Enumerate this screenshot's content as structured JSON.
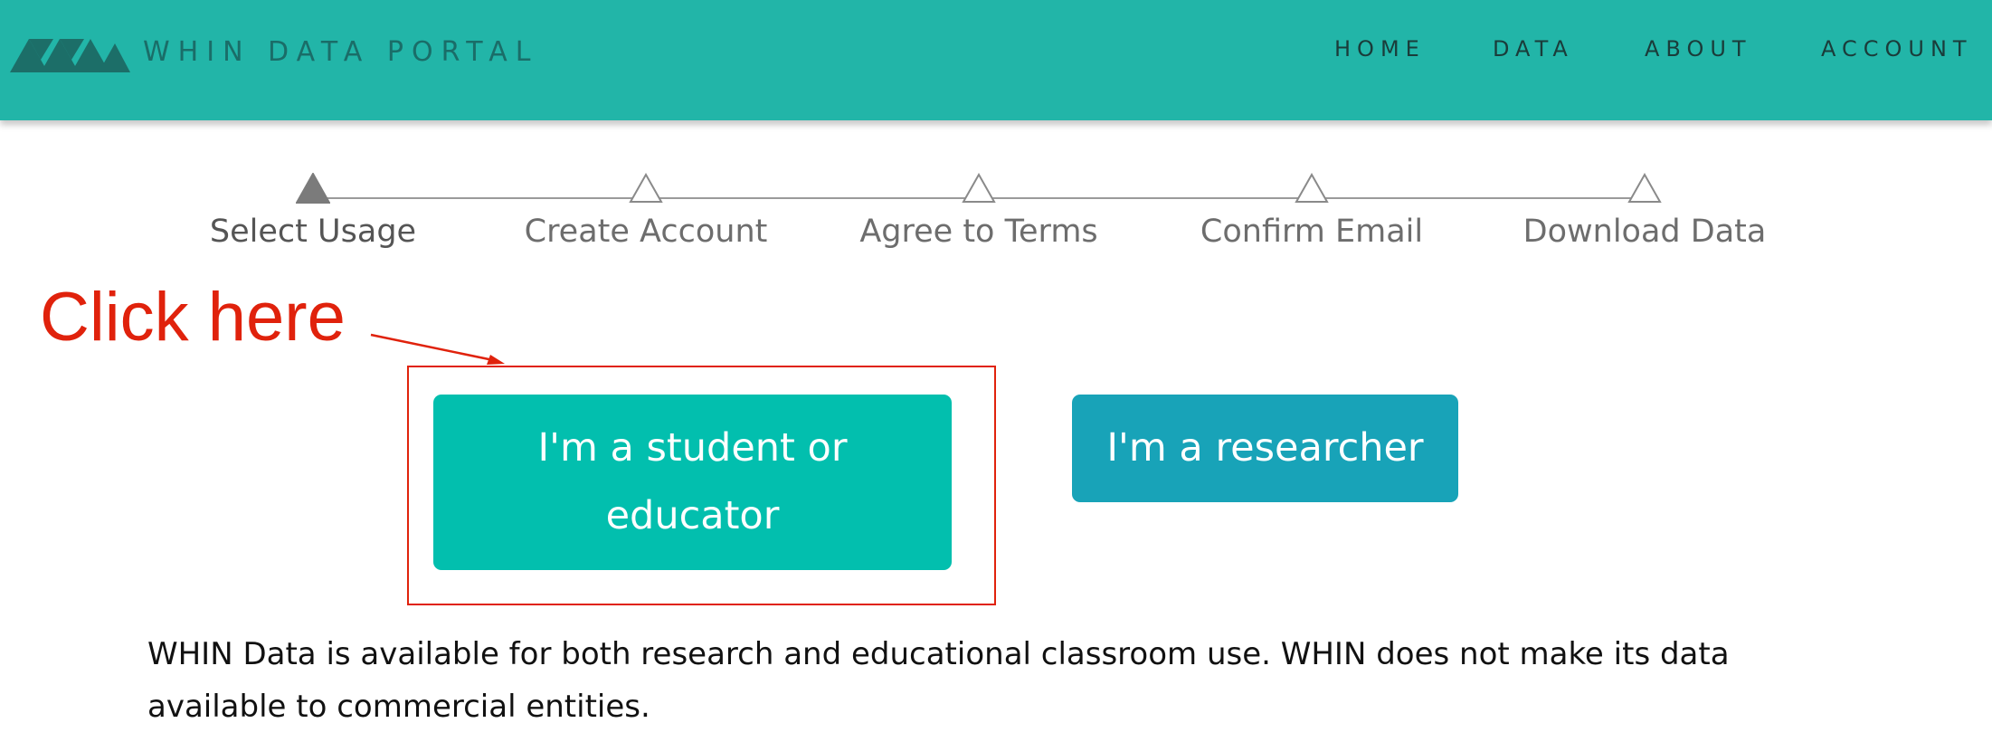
{
  "header": {
    "brand_title": "WHIN DATA PORTAL",
    "logo_icon": "triangle-mountains-icon",
    "nav": [
      {
        "label": "HOME"
      },
      {
        "label": "DATA"
      },
      {
        "label": "ABOUT"
      },
      {
        "label": "ACCOUNT"
      }
    ],
    "colors": {
      "background": "#22b5a8",
      "brand_text": "#1a6d68",
      "nav_text": "#1a3c3a"
    }
  },
  "stepper": {
    "active_index": 0,
    "steps": [
      {
        "label": "Select Usage",
        "icon": "filled-triangle-icon"
      },
      {
        "label": "Create Account",
        "icon": "outline-triangle-icon"
      },
      {
        "label": "Agree to Terms",
        "icon": "outline-triangle-icon"
      },
      {
        "label": "Confirm Email",
        "icon": "outline-triangle-icon"
      },
      {
        "label": "Download Data",
        "icon": "outline-triangle-icon"
      }
    ]
  },
  "annotation": {
    "text": "Click here",
    "color": "#e0220c"
  },
  "buttons": {
    "student_label": "I'm a student or educator",
    "researcher_label": "I'm a researcher",
    "student_color": "#02bfae",
    "researcher_color": "#18a3b8"
  },
  "description": "WHIN Data is available for both research and educational classroom use. WHIN does not make its data available to commercial entities."
}
